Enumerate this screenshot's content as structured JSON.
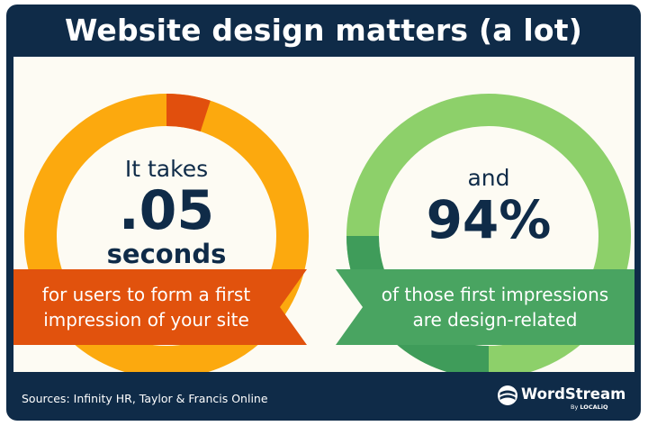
{
  "header": {
    "title": "Website design matters (a lot)"
  },
  "stat_left": {
    "line1": "It takes",
    "value": ".05",
    "line3": "seconds",
    "banner_line1": "for users to form a first",
    "banner_line2": "impression of your site",
    "ring_color": "#fca90e",
    "accent_color": "#e14f0d",
    "banner_color": "#e1520d",
    "accent_fraction": 0.05
  },
  "stat_right": {
    "line1": "and",
    "value": "94%",
    "banner_line1": "of those first impressions",
    "banner_line2": "are design-related",
    "light_color": "#8dd06a",
    "dark_color": "#3f9c5a",
    "banner_color": "#49a461",
    "light_fraction": 0.5,
    "dark_fraction": 0.25
  },
  "footer": {
    "sources": "Sources: Infinity HR, Taylor & Francis Online",
    "logo_name": "WordStream",
    "logo_by": "By",
    "logo_parent": "LOCALiQ",
    "logo_icon": "wordstream-logo-icon"
  },
  "colors": {
    "navy": "#0f2b48",
    "panel": "#fdfbf3"
  }
}
